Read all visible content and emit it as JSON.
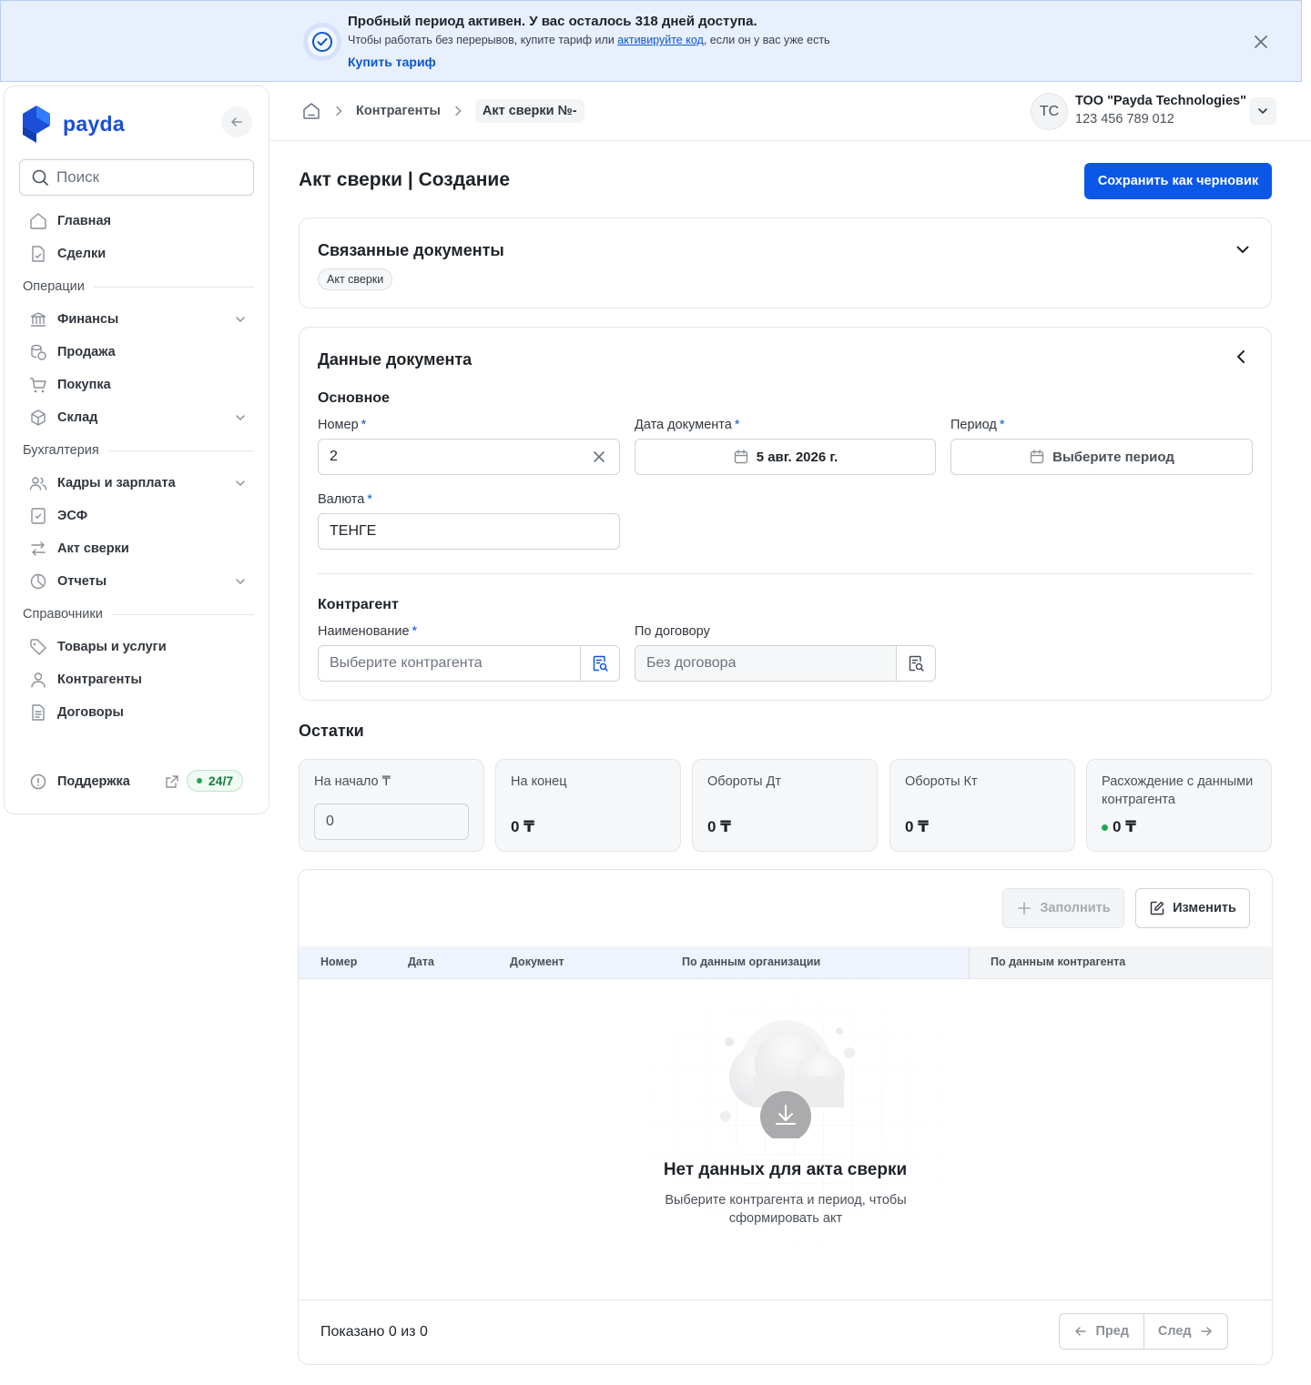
{
  "banner": {
    "title": "Пробный период активен. У вас осталось 318 дней доступа.",
    "text_before": "Чтобы работать без перерывов, купите тариф или ",
    "link": "активируйте код",
    "text_after": ", если он у вас уже есть",
    "buy": "Купить тариф"
  },
  "sidebar": {
    "logo": "payda",
    "search_placeholder": "Поиск",
    "items": [
      {
        "type": "item",
        "label": "Главная",
        "icon": "home-icon"
      },
      {
        "type": "item",
        "label": "Сделки",
        "icon": "deals-icon"
      },
      {
        "type": "section",
        "label": "Операции"
      },
      {
        "type": "item",
        "label": "Финансы",
        "icon": "bank-icon",
        "expand": true
      },
      {
        "type": "item",
        "label": "Продажа",
        "icon": "coins-icon"
      },
      {
        "type": "item",
        "label": "Покупка",
        "icon": "cart-icon"
      },
      {
        "type": "item",
        "label": "Склад",
        "icon": "box-icon",
        "expand": true
      },
      {
        "type": "section",
        "label": "Бухгалтерия"
      },
      {
        "type": "item",
        "label": "Кадры и зарплата",
        "icon": "users-icon",
        "expand": true
      },
      {
        "type": "item",
        "label": "ЭСФ",
        "icon": "invoice-icon"
      },
      {
        "type": "item",
        "label": "Акт сверки",
        "icon": "arrows-icon"
      },
      {
        "type": "item",
        "label": "Отчеты",
        "icon": "pie-icon",
        "expand": true
      },
      {
        "type": "section",
        "label": "Справочники"
      },
      {
        "type": "item",
        "label": "Товары и услуги",
        "icon": "tag-icon"
      },
      {
        "type": "item",
        "label": "Контрагенты",
        "icon": "user-icon"
      },
      {
        "type": "item",
        "label": "Договоры",
        "icon": "doc-icon"
      }
    ],
    "support": "Поддержка",
    "support_badge": "24/7"
  },
  "topbar": {
    "crumbs": [
      "Контрагенты",
      "Акт сверки №-"
    ],
    "avatar": "TC",
    "org_name": "ТОО \"Payda Technologies\"",
    "org_id": "123 456 789 012"
  },
  "page": {
    "title": "Акт сверки | Создание",
    "save_draft": "Сохранить как черновик"
  },
  "related": {
    "title": "Связанные документы",
    "chip": "Акт сверки"
  },
  "doc": {
    "title": "Данные документа",
    "basic": "Основное",
    "number_label": "Номер",
    "number_value": "2",
    "date_label": "Дата документа",
    "date_value": "5 авг. 2026 г.",
    "period_label": "Период",
    "period_placeholder": "Выберите период",
    "currency_label": "Валюта",
    "currency_value": "ТЕНГЕ",
    "counterparty": "Контрагент",
    "name_label": "Наименование",
    "name_placeholder": "Выберите контрагента",
    "contract_label": "По договору",
    "contract_placeholder": "Без договора",
    "required_mark": "*"
  },
  "balances": {
    "title": "Остатки",
    "cards": [
      {
        "label": "На начало ₸",
        "input": "0"
      },
      {
        "label": "На конец",
        "value": "0 ₸"
      },
      {
        "label": "Обороты Дт",
        "value": "0 ₸"
      },
      {
        "label": "Обороты Кт",
        "value": "0 ₸"
      },
      {
        "label": "Расхождение с данными контрагента",
        "value": "0 ₸",
        "dot": true
      }
    ]
  },
  "table": {
    "fill": "Заполнить",
    "edit": "Изменить",
    "cols": [
      "Номер",
      "Дата",
      "Документ",
      "По данным организации",
      "По данным контрагента"
    ],
    "empty_title": "Нет данных для акта сверки",
    "empty_desc": "Выберите контрагента и период, чтобы сформировать акт",
    "shown": "Показано 0 из 0",
    "prev": "Пред",
    "next": "След"
  },
  "colors": {
    "accent": "#0b57e8",
    "banner_bg": "#e8effd",
    "success": "#22a553"
  }
}
